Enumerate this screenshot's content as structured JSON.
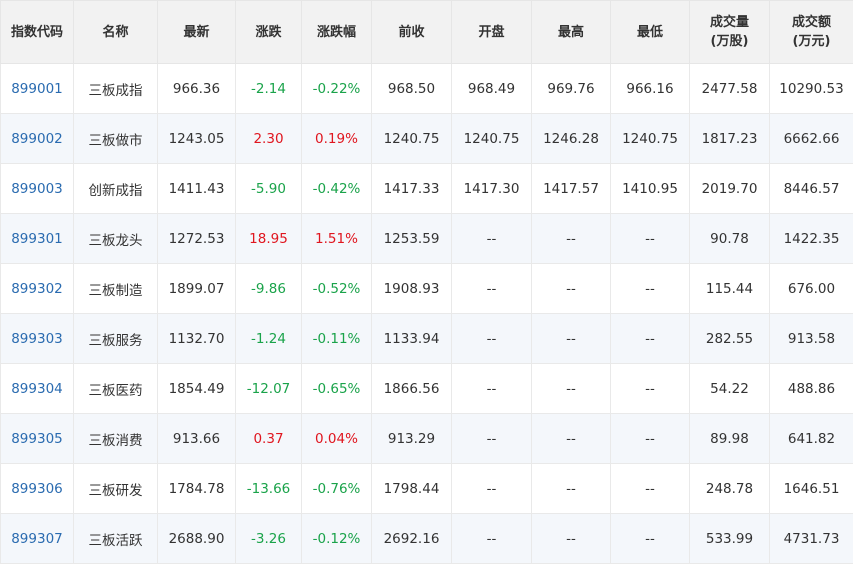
{
  "colors": {
    "up": "#e0161f",
    "down": "#1aa34a",
    "code_link": "#2a6bb0",
    "header_bg": "#f2f2f2",
    "alt_row_bg": "#f4f7fb"
  },
  "headers": [
    "指数代码",
    "名称",
    "最新",
    "涨跌",
    "涨跌幅",
    "前收",
    "开盘",
    "最高",
    "最低",
    "成交量\n(万股)",
    "成交额\n(万元)"
  ],
  "rows": [
    {
      "code": "899001",
      "name": "三板成指",
      "last": "966.36",
      "change": "-2.14",
      "change_pct": "-0.22%",
      "prev_close": "968.50",
      "open": "968.49",
      "high": "969.76",
      "low": "966.16",
      "volume": "2477.58",
      "amount": "10290.53",
      "direction": "down"
    },
    {
      "code": "899002",
      "name": "三板做市",
      "last": "1243.05",
      "change": "2.30",
      "change_pct": "0.19%",
      "prev_close": "1240.75",
      "open": "1240.75",
      "high": "1246.28",
      "low": "1240.75",
      "volume": "1817.23",
      "amount": "6662.66",
      "direction": "up"
    },
    {
      "code": "899003",
      "name": "创新成指",
      "last": "1411.43",
      "change": "-5.90",
      "change_pct": "-0.42%",
      "prev_close": "1417.33",
      "open": "1417.30",
      "high": "1417.57",
      "low": "1410.95",
      "volume": "2019.70",
      "amount": "8446.57",
      "direction": "down"
    },
    {
      "code": "899301",
      "name": "三板龙头",
      "last": "1272.53",
      "change": "18.95",
      "change_pct": "1.51%",
      "prev_close": "1253.59",
      "open": "--",
      "high": "--",
      "low": "--",
      "volume": "90.78",
      "amount": "1422.35",
      "direction": "up"
    },
    {
      "code": "899302",
      "name": "三板制造",
      "last": "1899.07",
      "change": "-9.86",
      "change_pct": "-0.52%",
      "prev_close": "1908.93",
      "open": "--",
      "high": "--",
      "low": "--",
      "volume": "115.44",
      "amount": "676.00",
      "direction": "down"
    },
    {
      "code": "899303",
      "name": "三板服务",
      "last": "1132.70",
      "change": "-1.24",
      "change_pct": "-0.11%",
      "prev_close": "1133.94",
      "open": "--",
      "high": "--",
      "low": "--",
      "volume": "282.55",
      "amount": "913.58",
      "direction": "down"
    },
    {
      "code": "899304",
      "name": "三板医药",
      "last": "1854.49",
      "change": "-12.07",
      "change_pct": "-0.65%",
      "prev_close": "1866.56",
      "open": "--",
      "high": "--",
      "low": "--",
      "volume": "54.22",
      "amount": "488.86",
      "direction": "down"
    },
    {
      "code": "899305",
      "name": "三板消费",
      "last": "913.66",
      "change": "0.37",
      "change_pct": "0.04%",
      "prev_close": "913.29",
      "open": "--",
      "high": "--",
      "low": "--",
      "volume": "89.98",
      "amount": "641.82",
      "direction": "up"
    },
    {
      "code": "899306",
      "name": "三板研发",
      "last": "1784.78",
      "change": "-13.66",
      "change_pct": "-0.76%",
      "prev_close": "1798.44",
      "open": "--",
      "high": "--",
      "low": "--",
      "volume": "248.78",
      "amount": "1646.51",
      "direction": "down"
    },
    {
      "code": "899307",
      "name": "三板活跃",
      "last": "2688.90",
      "change": "-3.26",
      "change_pct": "-0.12%",
      "prev_close": "2692.16",
      "open": "--",
      "high": "--",
      "low": "--",
      "volume": "533.99",
      "amount": "4731.73",
      "direction": "down"
    }
  ]
}
